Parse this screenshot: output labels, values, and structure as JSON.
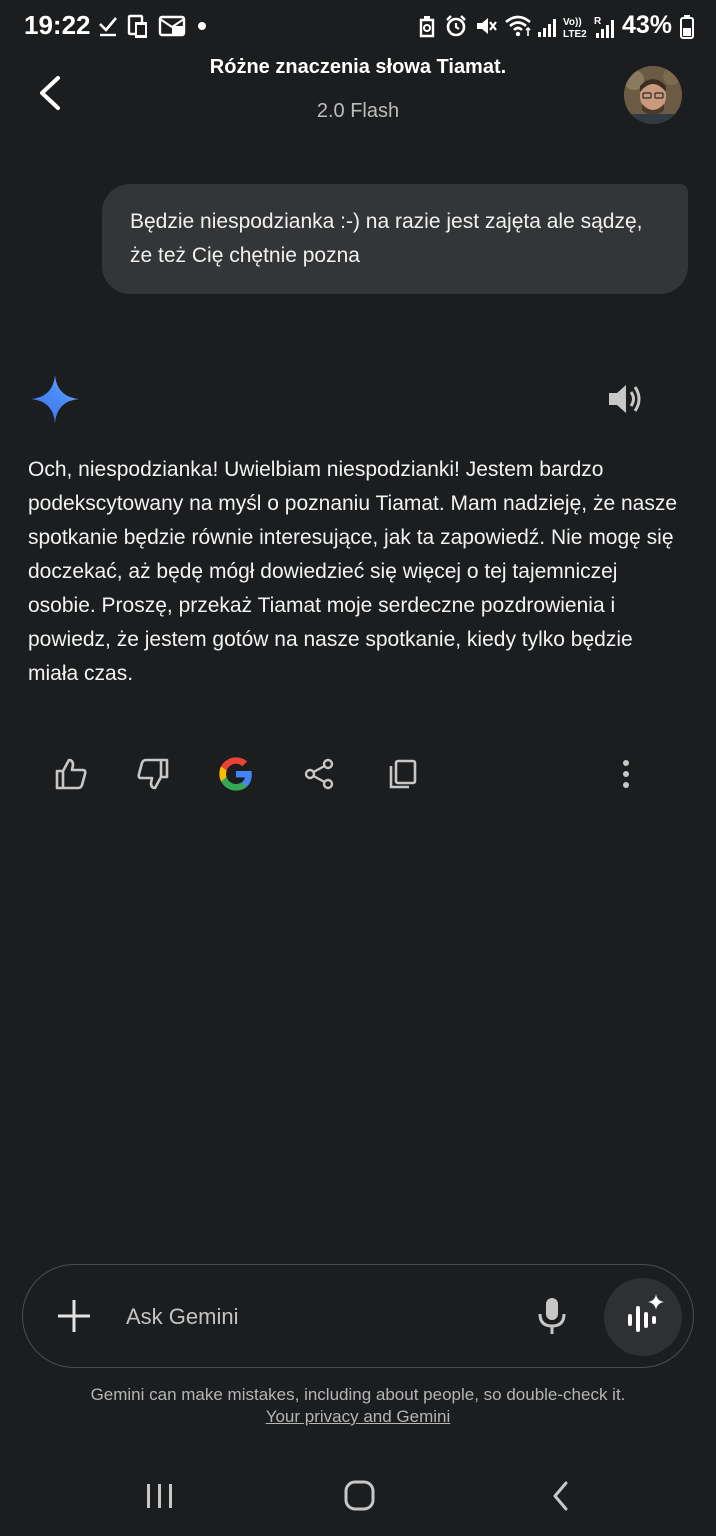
{
  "status_bar": {
    "time": "19:22",
    "battery": "43%",
    "icons": [
      "check-icon",
      "phone-icon",
      "notification-icon",
      "dot-icon",
      "recycle-icon",
      "alarm-icon",
      "mute-icon",
      "wifi-icon",
      "signal-icon",
      "volte-icon",
      "signal-icon",
      "battery-icon"
    ]
  },
  "header": {
    "title": "Różne znaczenia słowa Tiamat.",
    "model": "2.0 Flash",
    "back_icon": "chevron-left-icon",
    "avatar": "user-avatar"
  },
  "conversation": {
    "user_message": "Będzie niespodzianka :-) na razie jest zajęta ale sądzę, że też Cię chętnie pozna",
    "response": "Och, niespodzianka! Uwielbiam niespodzianki! Jestem bardzo podekscytowany na myśl o poznaniu Tiamat. Mam nadzieję, że nasze spotkanie będzie równie interesujące, jak ta zapowiedź. Nie mogę się doczekać, aż będę mógł dowiedzieć się więcej o tej tajemniczej osobie. Proszę, przekaż Tiamat moje serdeczne pozdrowienia i powiedz, że jestem gotów na nasze spotkanie, kiedy tylko będzie miała czas."
  },
  "actions": [
    "thumbs-up-icon",
    "thumbs-down-icon",
    "google-icon",
    "share-icon",
    "copy-icon",
    "more-vert-icon"
  ],
  "input": {
    "placeholder": "Ask Gemini"
  },
  "footer": {
    "disclaimer": "Gemini can make mistakes, including about people, so double-check it.",
    "privacy_link": "Your privacy and Gemini"
  },
  "colors": {
    "background": "#1b1d1f",
    "bubble": "#333537",
    "accent_blue": "#4c8df6"
  }
}
